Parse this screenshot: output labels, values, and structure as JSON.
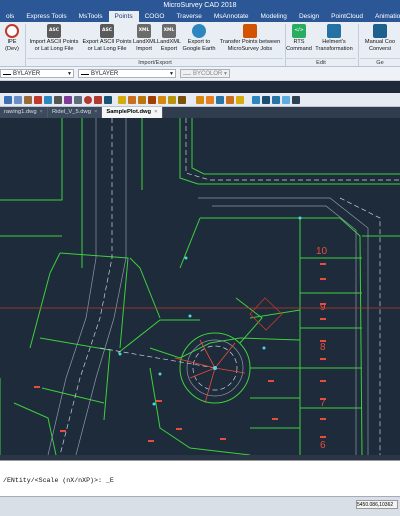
{
  "app": {
    "title": "MicroSurvey CAD 2018"
  },
  "tabs": [
    "ols",
    "Express Tools",
    "MsTools",
    "Points",
    "COGO",
    "Traverse",
    "MsAnnotate",
    "Modeling",
    "Design",
    "PointCloud",
    "Animation"
  ],
  "ribbon": {
    "buttons": [
      {
        "label": "IPE\n(Dev)",
        "icon_text": "",
        "color": "#c0392b"
      },
      {
        "label": "Import ASCII Points\nor Lat Long File",
        "icon_text": "ASC",
        "color": "#5a5a5a"
      },
      {
        "label": "Export ASCII Points\nor Lat Long File",
        "icon_text": "ASC",
        "color": "#5a5a5a"
      },
      {
        "label": "LandXML\nImport",
        "icon_text": "XML",
        "color": "#6b6b6b"
      },
      {
        "label": "LandXML\nExport",
        "icon_text": "XML",
        "color": "#6b6b6b"
      },
      {
        "label": "Export to\nGoogle Earth",
        "icon_text": "",
        "color": "#2e86c1"
      },
      {
        "label": "Transfer Points between\nMicroSurvey Jobs",
        "icon_text": "",
        "color": "#d35400"
      },
      {
        "label": "RTS\nCommand",
        "icon_text": "</>",
        "color": "#27ae60"
      },
      {
        "label": "Helmert's\nTransformation",
        "icon_text": "",
        "color": "#2471a3"
      },
      {
        "label": "Manual Coo\nConversi",
        "icon_text": "",
        "color": "#1f618d"
      }
    ],
    "groups": [
      "Import/Export",
      "Edit",
      "Ge"
    ]
  },
  "properties": {
    "layer1": "BYLAYER",
    "layer2": "BYLAYER",
    "color": "BYCOLOR"
  },
  "documents": [
    {
      "name": "rawing1.dwg",
      "active": false
    },
    {
      "name": "Ridel_V_5.dwg",
      "active": false
    },
    {
      "name": "SamplePlot.dwg",
      "active": true
    }
  ],
  "drawing": {
    "lot_numbers": [
      "10",
      "9",
      "8",
      "7",
      "6"
    ]
  },
  "command": {
    "text": "/ENtity/<Scale (nX/nXP)>: _E"
  },
  "status": {
    "coordinates": "5450.086,10362"
  }
}
